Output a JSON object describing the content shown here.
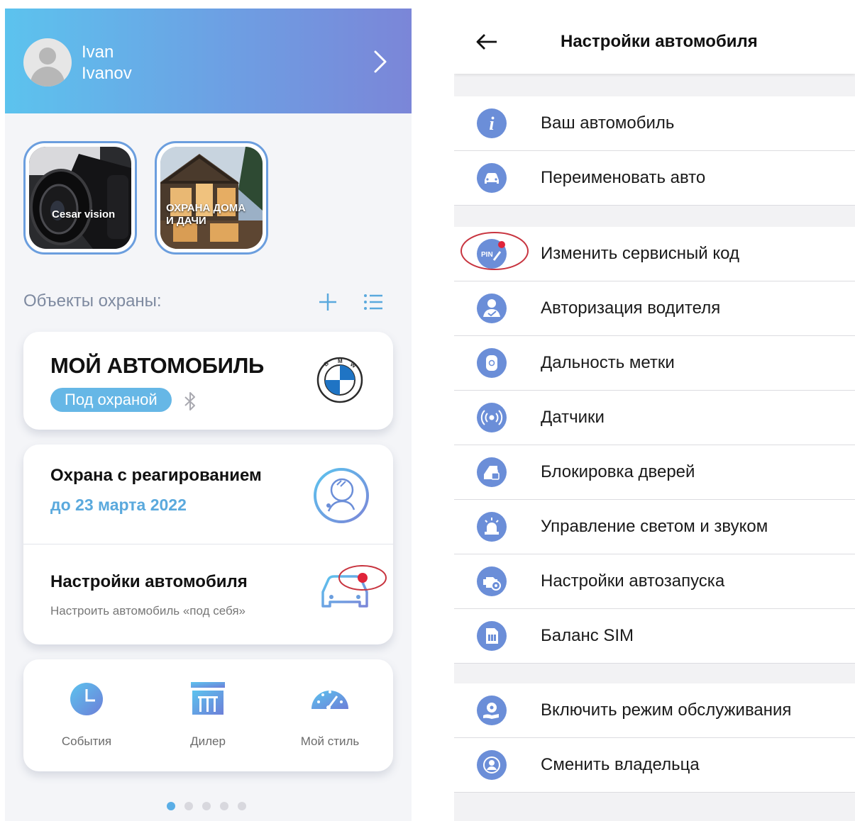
{
  "left": {
    "user": {
      "first_name": "Ivan",
      "last_name": "Ivanov"
    },
    "stories": [
      {
        "label": "Cesar vision"
      },
      {
        "label": "ОХРАНА ДОМА И ДАЧИ"
      }
    ],
    "objects_title": "Объекты охраны:",
    "car_card": {
      "title": "МОЙ АВТОМОБИЛЬ",
      "badge": "Под охраной"
    },
    "service_card": {
      "title": "Охрана с реагированием",
      "date": "до 23 марта 2022",
      "settings_title": "Настройки автомобиля",
      "settings_subtitle": "Настроить автомобиль «под себя»"
    },
    "nav": [
      {
        "label": "События",
        "icon": "clock-icon"
      },
      {
        "label": "Дилер",
        "icon": "dealer-icon"
      },
      {
        "label": "Мой стиль",
        "icon": "speedometer-icon"
      }
    ],
    "pager": {
      "pages": 5,
      "active": 1
    }
  },
  "right": {
    "title": "Настройки автомобиля",
    "groups": [
      [
        {
          "label": "Ваш автомобиль",
          "icon": "info-icon"
        },
        {
          "label": "Переименовать авто",
          "icon": "car-icon"
        }
      ],
      [
        {
          "label": "Изменить сервисный код",
          "icon": "pin-code-icon"
        },
        {
          "label": "Авторизация водителя",
          "icon": "driver-check-icon"
        },
        {
          "label": "Дальность метки",
          "icon": "tag-icon"
        },
        {
          "label": "Датчики",
          "icon": "sensor-icon"
        },
        {
          "label": "Блокировка дверей",
          "icon": "door-lock-icon"
        },
        {
          "label": "Управление светом и звуком",
          "icon": "siren-icon"
        },
        {
          "label": "Настройки автозапуска",
          "icon": "engine-gear-icon"
        },
        {
          "label": "Баланс SIM",
          "icon": "sim-card-icon"
        }
      ],
      [
        {
          "label": "Включить режим обслуживания",
          "icon": "service-mode-icon"
        },
        {
          "label": "Сменить владельца",
          "icon": "owner-icon"
        }
      ]
    ]
  },
  "colors": {
    "accent": "#66b7e6",
    "header_start": "#5cc3ee",
    "header_end": "#7b86d8",
    "menu_icon": "#6b8ed8",
    "highlight_circle": "#c8343f"
  }
}
